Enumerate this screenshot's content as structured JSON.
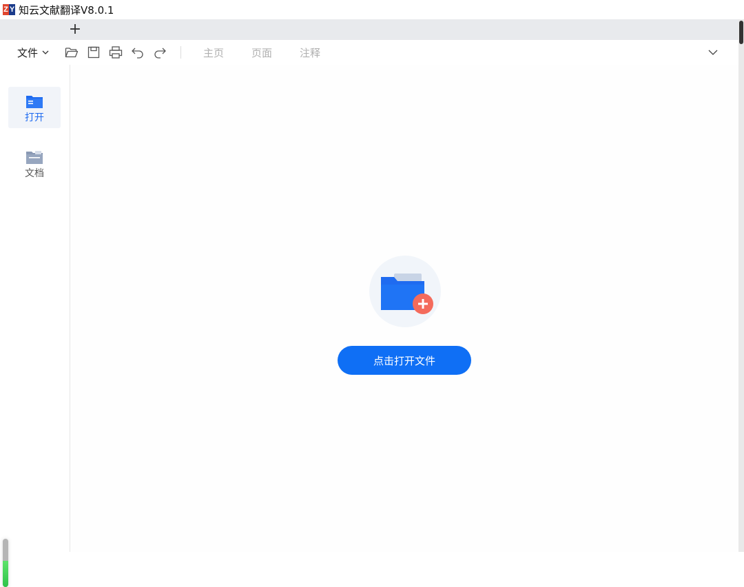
{
  "window": {
    "title": "知云文献翻译V8.0.1",
    "logo_letters": [
      "Z",
      "Y"
    ]
  },
  "tabstrip": {
    "add_tab_label": "+"
  },
  "toolbar": {
    "file_menu_label": "文件",
    "icons": [
      "open-folder-icon",
      "save-icon",
      "print-icon",
      "undo-icon",
      "redo-icon"
    ],
    "ribbon_tabs": [
      "主页",
      "页面",
      "注释"
    ],
    "collapse_icon": "chevron-down-icon"
  },
  "sidebar": {
    "items": [
      {
        "label": "打开",
        "icon": "open-folder-icon",
        "active": true
      },
      {
        "label": "文档",
        "icon": "document-folder-icon",
        "active": false
      }
    ]
  },
  "main": {
    "open_button_label": "点击打开文件",
    "hero_icon": "folder-add-icon"
  },
  "colors": {
    "accent": "#0f6ff5",
    "active_label": "#1f6bf0",
    "plus_badge": "#f46b5c"
  },
  "status": {
    "progress_fraction": 0.55
  }
}
